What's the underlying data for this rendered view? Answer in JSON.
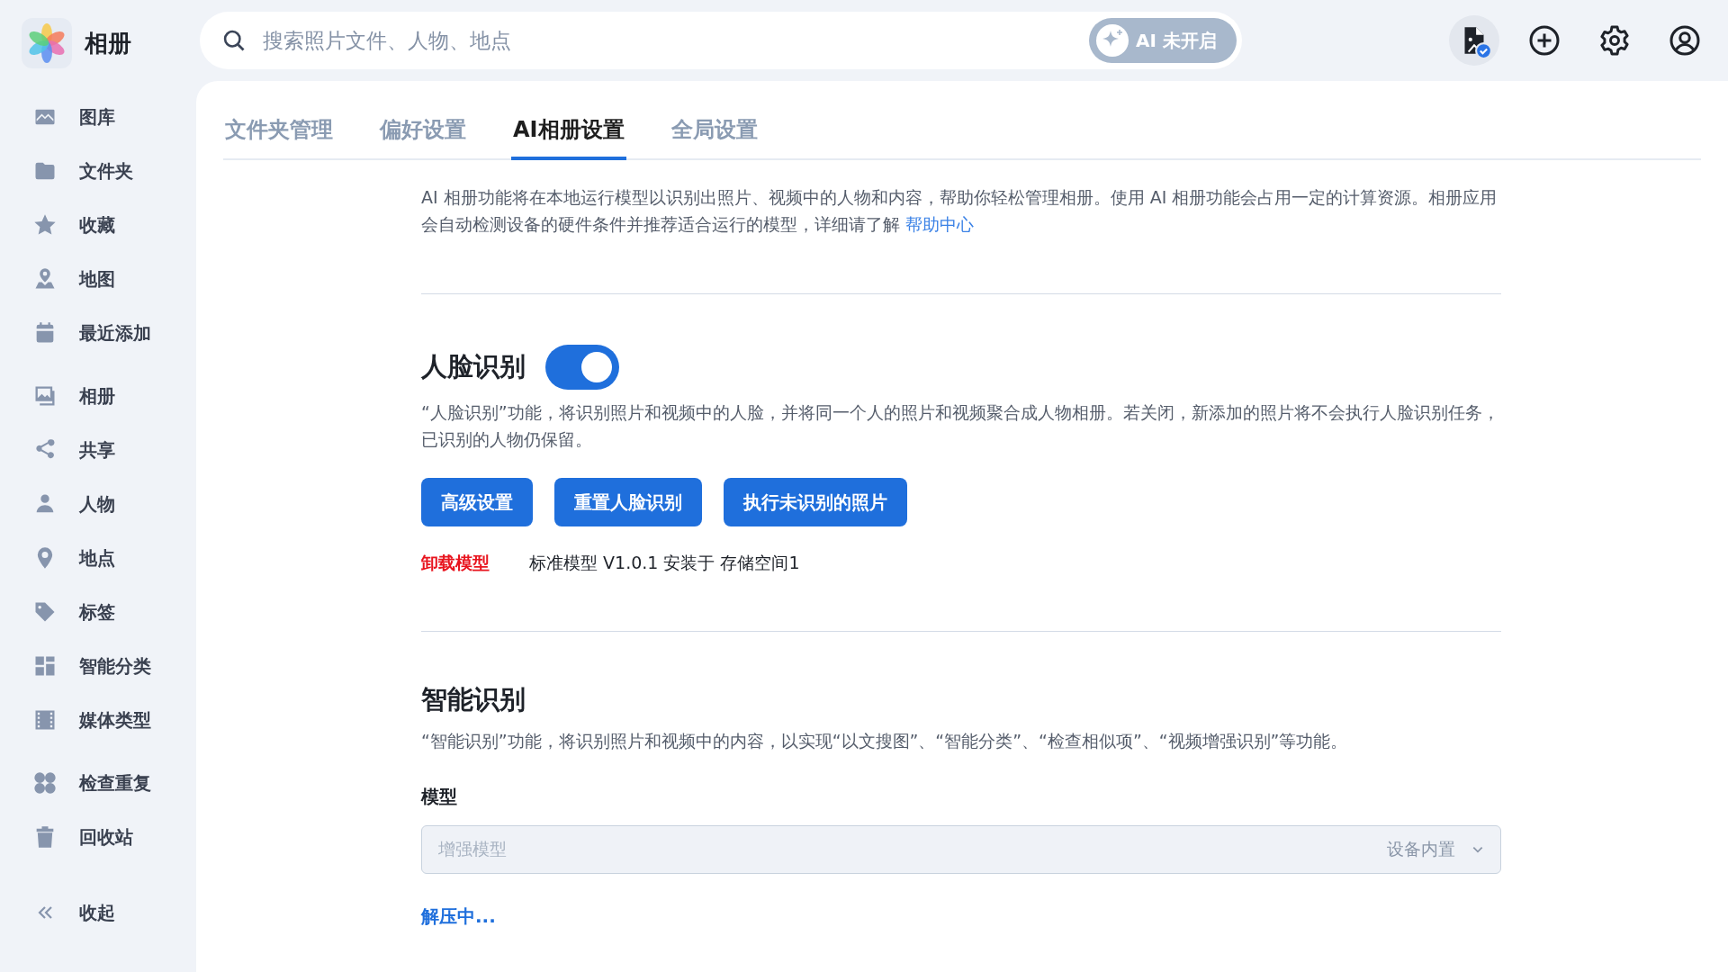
{
  "app": {
    "title": "相册"
  },
  "sidebar": {
    "groups": [
      {
        "items": [
          {
            "label": "图库"
          },
          {
            "label": "文件夹"
          },
          {
            "label": "收藏"
          },
          {
            "label": "地图"
          },
          {
            "label": "最近添加"
          }
        ]
      },
      {
        "items": [
          {
            "label": "相册"
          },
          {
            "label": "共享"
          },
          {
            "label": "人物"
          },
          {
            "label": "地点"
          },
          {
            "label": "标签"
          },
          {
            "label": "智能分类"
          },
          {
            "label": "媒体类型"
          }
        ]
      },
      {
        "items": [
          {
            "label": "检查重复"
          },
          {
            "label": "回收站"
          }
        ]
      }
    ],
    "collapse": {
      "label": "收起"
    }
  },
  "search": {
    "placeholder": "搜索照片文件、人物、地点"
  },
  "ai_button": {
    "label": "AI 未开启"
  },
  "tabs": [
    {
      "label": "文件夹管理",
      "selected": false
    },
    {
      "label": "偏好设置",
      "selected": false
    },
    {
      "label": "AI相册设置",
      "selected": true
    },
    {
      "label": "全局设置",
      "selected": false
    }
  ],
  "intro": {
    "text": "AI 相册功能将在本地运行模型以识别出照片、视频中的人物和内容，帮助你轻松管理相册。使用 AI 相册功能会占用一定的计算资源。相册应用会自动检测设备的硬件条件并推荐适合运行的模型，详细请了解",
    "link": "帮助中心"
  },
  "face": {
    "title": "人脸识别",
    "on": true,
    "description": "“人脸识别”功能，将识别照片和视频中的人脸，并将同一个人的照片和视频聚合成人物相册。若关闭，新添加的照片将不会执行人脸识别任务，已识别的人物仍保留。",
    "buttons": [
      "高级设置",
      "重置人脸识别",
      "执行未识别的照片"
    ],
    "uninstall": "卸载模型",
    "model_info": "标准模型 V1.0.1 安装于 存储空间1"
  },
  "smart": {
    "title": "智能识别",
    "description": "“智能识别”功能，将识别照片和视频中的内容，以实现“以文搜图”、“智能分类”、“检查相似项”、“视频增强识别”等功能。",
    "model_label": "模型",
    "model_select": {
      "value": "增强模型",
      "source": "设备内置",
      "disabled": true
    },
    "status": "解压中..."
  }
}
